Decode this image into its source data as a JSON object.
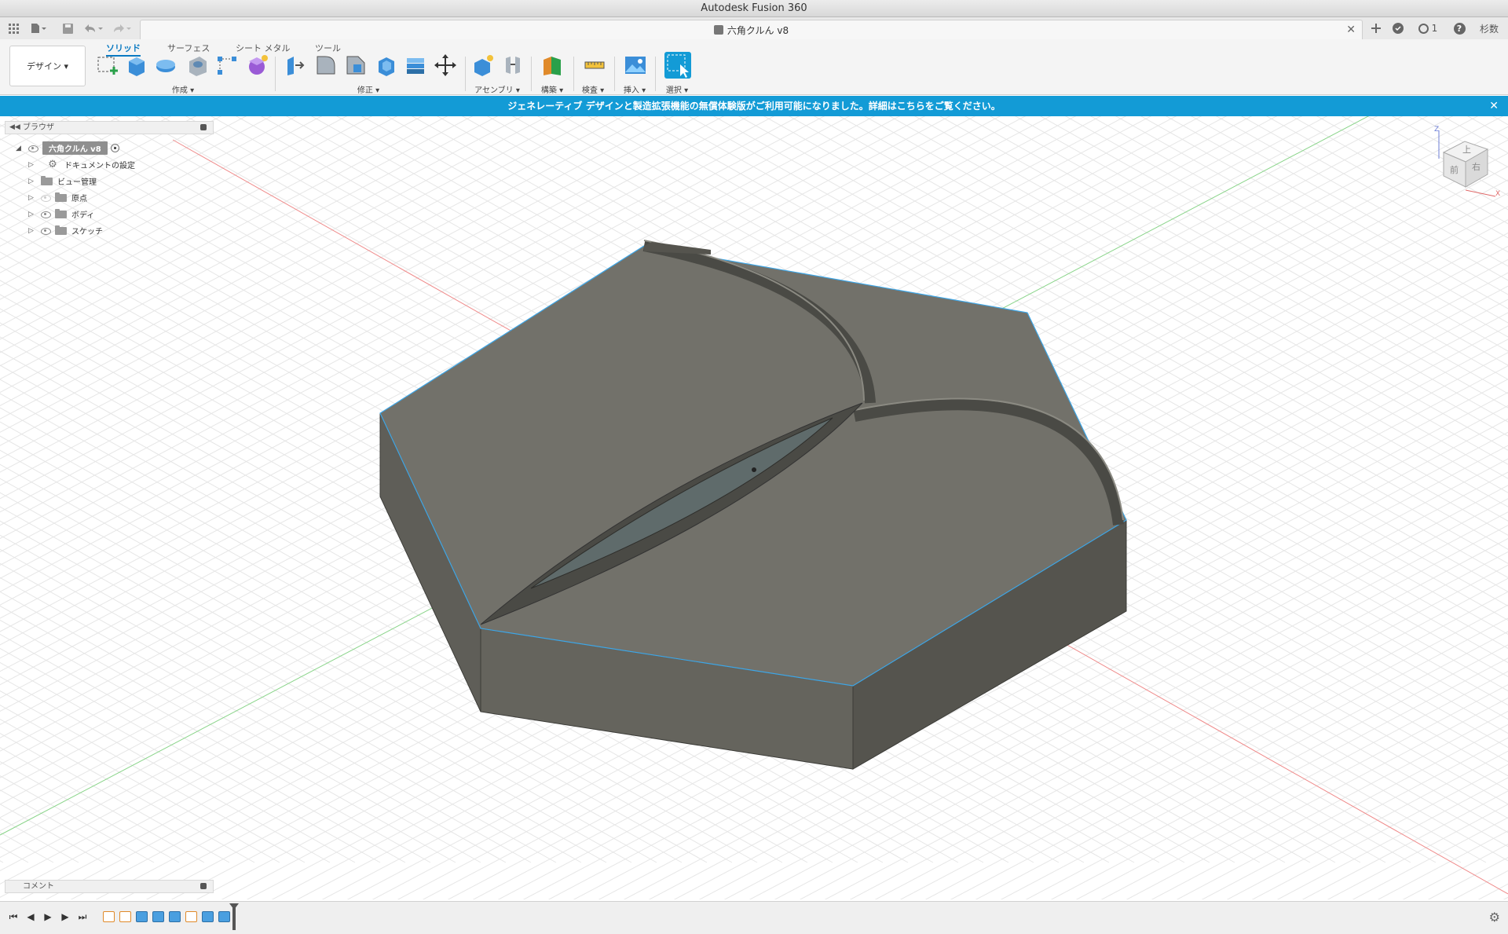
{
  "window": {
    "title": "Autodesk Fusion 360"
  },
  "document": {
    "tab_title": "六角クルん v8"
  },
  "toolbar_right": {
    "job_count": "1",
    "user": "杉数"
  },
  "ribbon": {
    "workspace": "デザイン ▾",
    "tabs": [
      "ソリッド",
      "サーフェス",
      "シート メタル",
      "ツール"
    ],
    "groups": [
      "作成 ▾",
      "修正 ▾",
      "アセンブリ ▾",
      "構築 ▾",
      "検査 ▾",
      "挿入 ▾",
      "選択 ▾"
    ]
  },
  "banner": {
    "text": "ジェネレーティブ デザインと製造拡張機能の無償体験版がご利用可能になりました。詳細はこちらをご覧ください。"
  },
  "browser": {
    "title": "ブラウザ",
    "root": "六角クルん v8",
    "items": [
      "ドキュメントの設定",
      "ビュー管理",
      "原点",
      "ボディ",
      "スケッチ"
    ]
  },
  "viewcube": {
    "top": "上",
    "front": "前",
    "right": "右",
    "axis_z": "Z",
    "axis_x": "X"
  },
  "comments": {
    "title": "コメント"
  },
  "colors": {
    "accent": "#139bd6",
    "model": "#6e6e68",
    "edge_highlight": "#3ea6e6"
  }
}
